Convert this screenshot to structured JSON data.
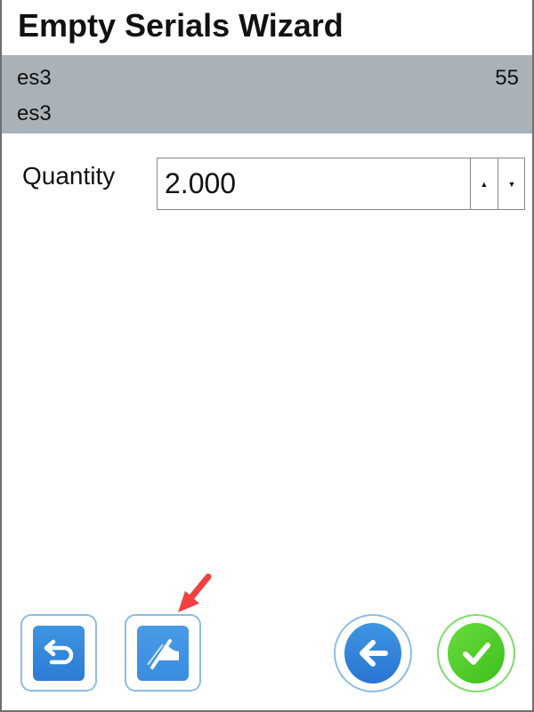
{
  "title": "Empty Serials Wizard",
  "item": {
    "line1": "es3",
    "line2": "es3",
    "count": "55"
  },
  "quantity": {
    "label": "Quantity",
    "value": "2.000"
  },
  "colors": {
    "header_band": "#a9b2b9",
    "blue_button": "#2c7bd6",
    "green_button": "#46c726",
    "annotation_arrow": "#f04040"
  },
  "buttons": [
    "undo-icon",
    "signature-icon",
    "back-arrow-icon",
    "confirm-check-icon"
  ]
}
